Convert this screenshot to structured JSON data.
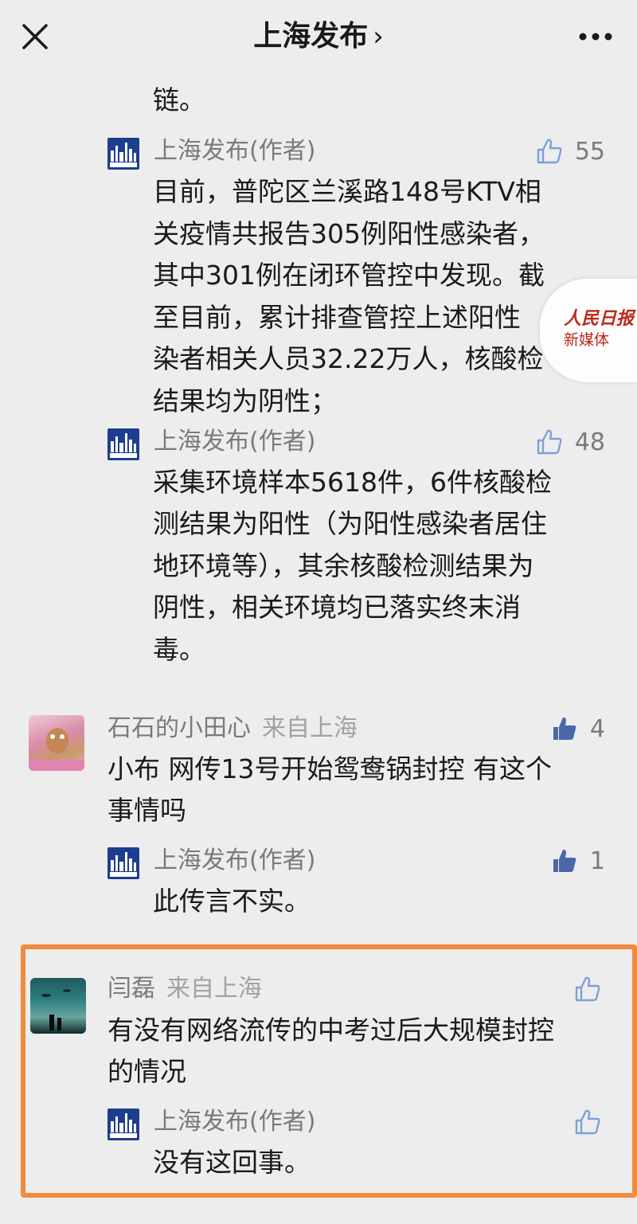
{
  "nav": {
    "title": "上海发布",
    "chevron": "›",
    "close_icon": "close-icon",
    "more_icon": "more-icon"
  },
  "comments": [
    {
      "text_lines": [
        "链。"
      ]
    },
    {
      "author": "上海发布(作者)",
      "likes": "55",
      "text_lines": [
        "目前，普陀区兰溪路148号KTV相",
        "关疫情共报告305例阳性感染者，",
        "其中301例在闭环管控中发现。截",
        "至目前，累计排查管控上述阳性",
        "染者相关人员32.22万人，核酸检",
        "结果均为阴性；"
      ]
    },
    {
      "author": "上海发布(作者)",
      "likes": "48",
      "text_lines": [
        "采集环境样本5618件，6件核酸检",
        "测结果为阳性（为阳性感染者居住",
        "地环境等），其余核酸检测结果为",
        "阴性，相关环境均已落实终末消",
        "毒。"
      ]
    },
    {
      "user": "石石的小田心",
      "location": "来自上海",
      "likes": "4",
      "text_lines": [
        "小布 网传13号开始鸳鸯锅封控 有这个",
        "事情吗"
      ],
      "reply": {
        "author": "上海发布(作者)",
        "likes": "1",
        "text": "此传言不实。"
      }
    },
    {
      "user": "闫磊",
      "location": "来自上海",
      "text_lines": [
        "有没有网络流传的中考过后大规模封控",
        "的情况"
      ],
      "reply": {
        "author": "上海发布(作者)",
        "text": "没有这回事。"
      }
    }
  ],
  "watermark": {
    "top": "人民日报",
    "bottom": "新媒体"
  },
  "colors": {
    "highlight": "#f08b3e",
    "author_badge": "#1d3d8f",
    "watermark_red": "#c0281a"
  }
}
